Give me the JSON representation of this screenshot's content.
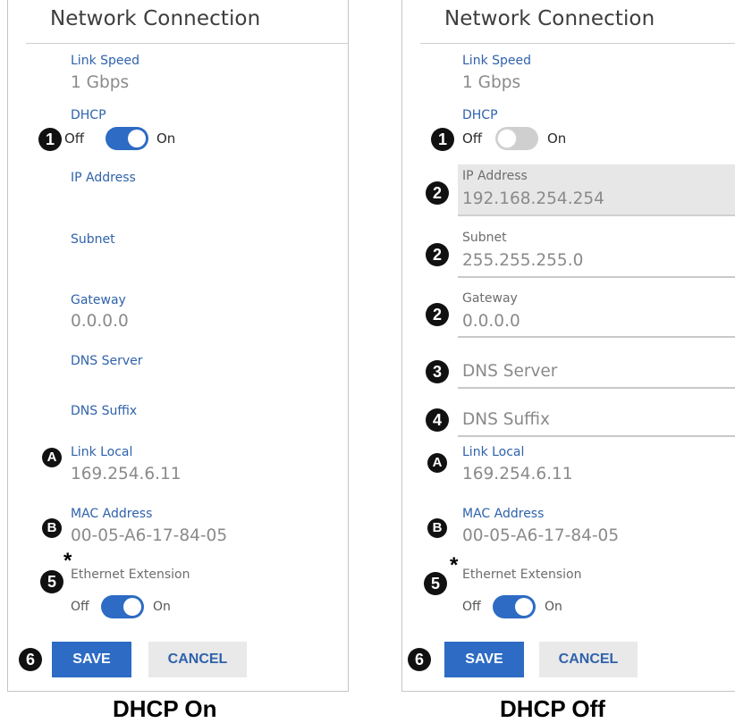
{
  "panels": {
    "left": {
      "title": "Network Connection",
      "link_speed": {
        "label": "Link Speed",
        "value": "1 Gbps"
      },
      "dhcp": {
        "label": "DHCP",
        "off_label": "Off",
        "on_label": "On",
        "state": "on"
      },
      "ip_address": {
        "label": "IP Address",
        "value": ""
      },
      "subnet": {
        "label": "Subnet",
        "value": ""
      },
      "gateway": {
        "label": "Gateway",
        "value": "0.0.0.0"
      },
      "dns_server": {
        "label": "DNS Server",
        "value": ""
      },
      "dns_suffix": {
        "label": "DNS Suffix",
        "value": ""
      },
      "link_local": {
        "label": "Link Local",
        "value": "169.254.6.11"
      },
      "mac_address": {
        "label": "MAC Address",
        "value": "00-05-A6-17-84-05"
      },
      "ethernet_extension": {
        "label": "Ethernet Extension",
        "off_label": "Off",
        "on_label": "On",
        "state": "on"
      },
      "save_label": "SAVE",
      "cancel_label": "CANCEL",
      "caption": "DHCP On"
    },
    "right": {
      "title": "Network Connection",
      "link_speed": {
        "label": "Link Speed",
        "value": "1 Gbps"
      },
      "dhcp": {
        "label": "DHCP",
        "off_label": "Off",
        "on_label": "On",
        "state": "off"
      },
      "ip_address": {
        "label": "IP Address",
        "value": "192.168.254.254"
      },
      "subnet": {
        "label": "Subnet",
        "value": "255.255.255.0"
      },
      "gateway": {
        "label": "Gateway",
        "value": "0.0.0.0"
      },
      "dns_server": {
        "placeholder": "DNS Server"
      },
      "dns_suffix": {
        "placeholder": "DNS Suffix"
      },
      "link_local": {
        "label": "Link Local",
        "value": "169.254.6.11"
      },
      "mac_address": {
        "label": "MAC Address",
        "value": "00-05-A6-17-84-05"
      },
      "ethernet_extension": {
        "label": "Ethernet Extension",
        "off_label": "Off",
        "on_label": "On",
        "state": "on"
      },
      "save_label": "SAVE",
      "cancel_label": "CANCEL",
      "caption": "DHCP Off"
    }
  },
  "callouts": {
    "dhcp_toggle": "1",
    "static_fields": "2",
    "dns_server": "3",
    "dns_suffix": "4",
    "ethernet_extension": "5",
    "save": "6",
    "link_local": "A",
    "mac_address": "B",
    "asterisk": "*"
  },
  "colors": {
    "accent": "#2d6bc4",
    "label": "#2f62ab",
    "value": "#8a8a8a",
    "disabled_field": "#e7e7e7",
    "toggle_off": "#cfcfcf"
  }
}
